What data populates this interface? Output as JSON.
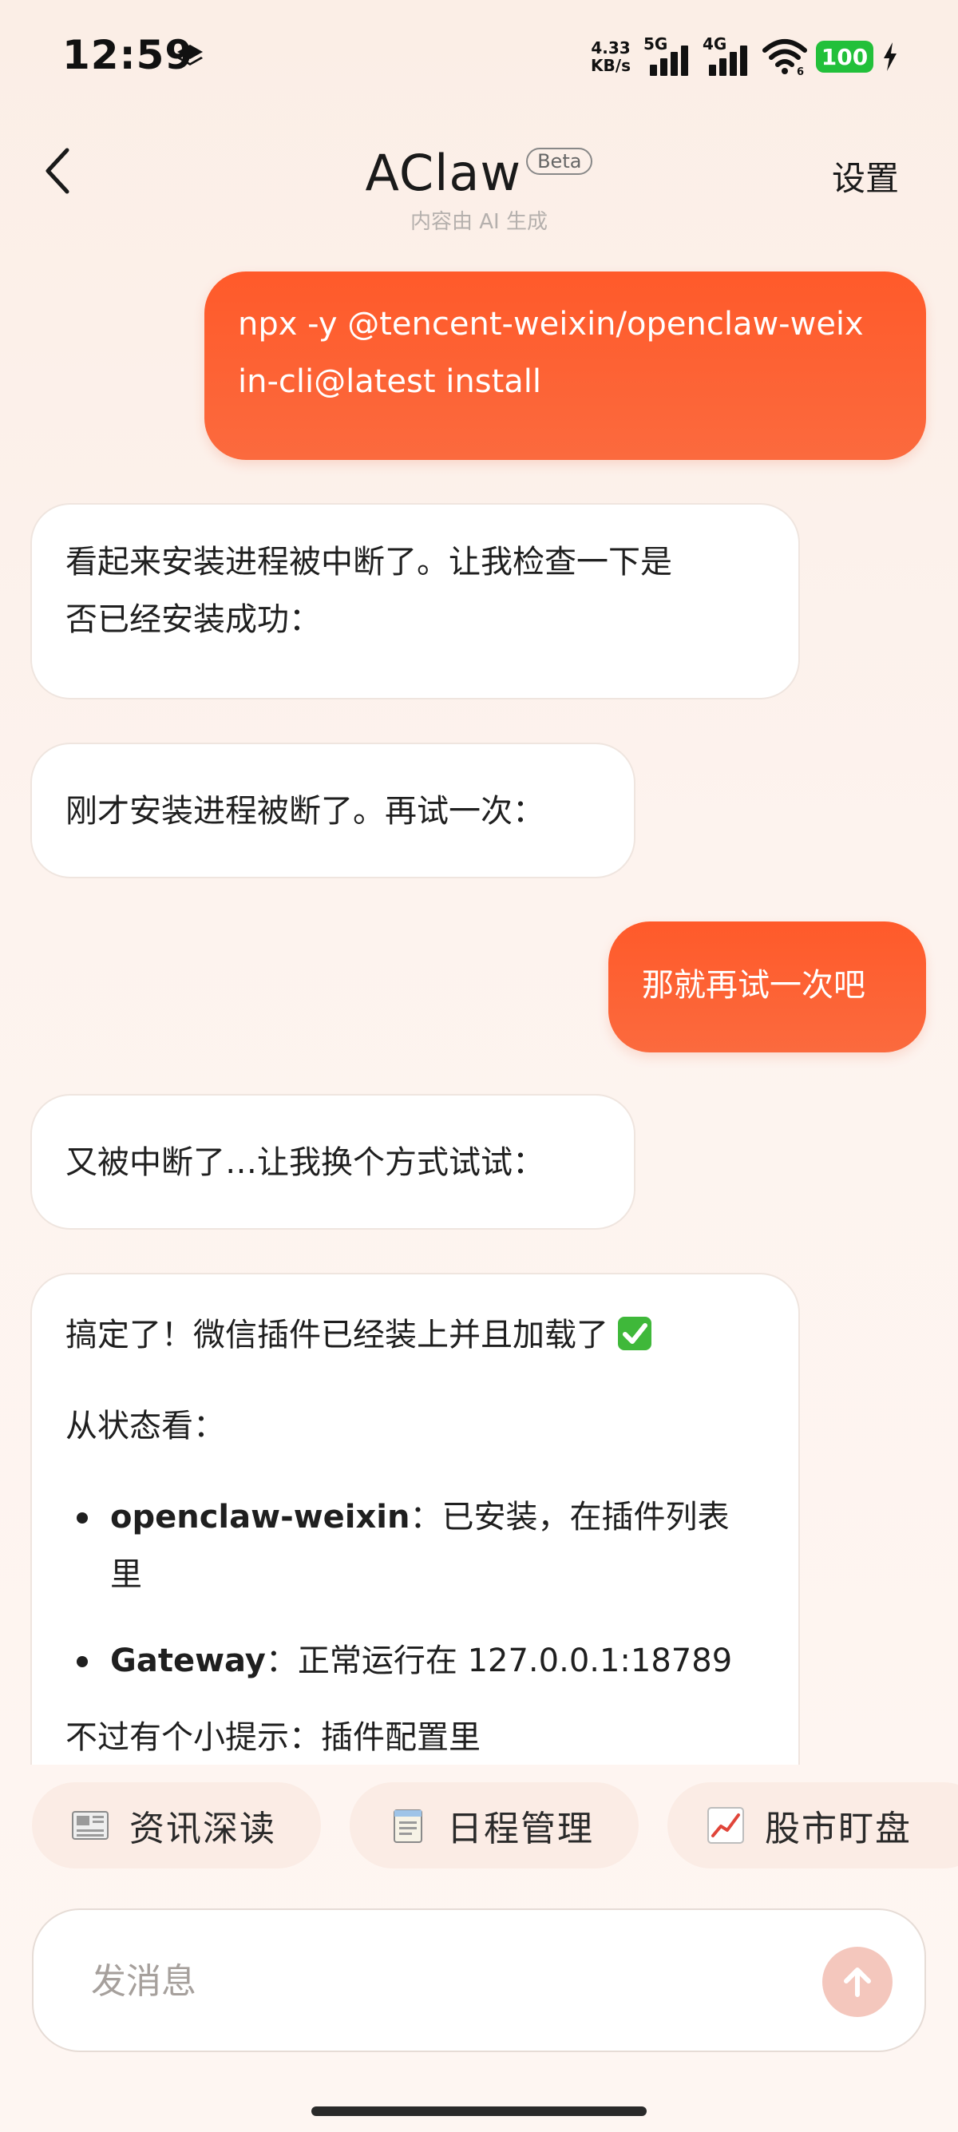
{
  "status_bar": {
    "time": "12:59",
    "net_speed_value": "4.33",
    "net_speed_unit": "KB/s",
    "signal_1_label": "5G",
    "signal_2_label": "4G",
    "battery": "100",
    "icons": [
      "layers-icon",
      "signal-icon",
      "wifi-icon",
      "battery-icon",
      "charging-bolt-icon"
    ]
  },
  "header": {
    "back_icon": "chevron-left-icon",
    "title": "AClaw",
    "badge": "Beta",
    "subtitle": "内容由 AI 生成",
    "settings_label": "设置"
  },
  "messages": [
    {
      "role": "user",
      "lines": [
        "npx -y @tencent-weixin/openclaw-weix",
        "in-cli@latest install"
      ]
    },
    {
      "role": "assistant",
      "lines": [
        "看起来安装进程被中断了。让我检查一下是",
        "否已经安装成功："
      ]
    },
    {
      "role": "assistant",
      "lines": [
        "刚才安装进程被断了。再试一次："
      ]
    },
    {
      "role": "user",
      "lines": [
        "那就再试一次吧"
      ]
    },
    {
      "role": "assistant",
      "lines": [
        "又被中断了…让我换个方式试试："
      ]
    },
    {
      "role": "assistant",
      "intro": "搞定了！微信插件已经装上并且加载了",
      "status_heading": "从状态看：",
      "bullets": [
        {
          "key": "openclaw-weixin",
          "sep": "：",
          "text_1": "已安装，在插件列表",
          "text_2": "里"
        },
        {
          "key": "Gateway",
          "sep": "：",
          "text_1": "正常运行在 127.0.0.1:18789"
        }
      ],
      "tail": "不过有个小提示：插件配置里"
    }
  ],
  "quick_actions": [
    {
      "icon": "newspaper-icon",
      "label": "资讯深读"
    },
    {
      "icon": "notepad-icon",
      "label": "日程管理"
    },
    {
      "icon": "chart-increasing-icon",
      "label": "股市盯盘"
    }
  ],
  "composer": {
    "placeholder": "发消息",
    "value": "",
    "send_icon": "arrow-up-icon"
  },
  "colors": {
    "accent": "#ff5a2a",
    "send_button_disabled": "#f4c7bd",
    "battery": "#22c03a",
    "check_mark": "#3fb83a"
  }
}
